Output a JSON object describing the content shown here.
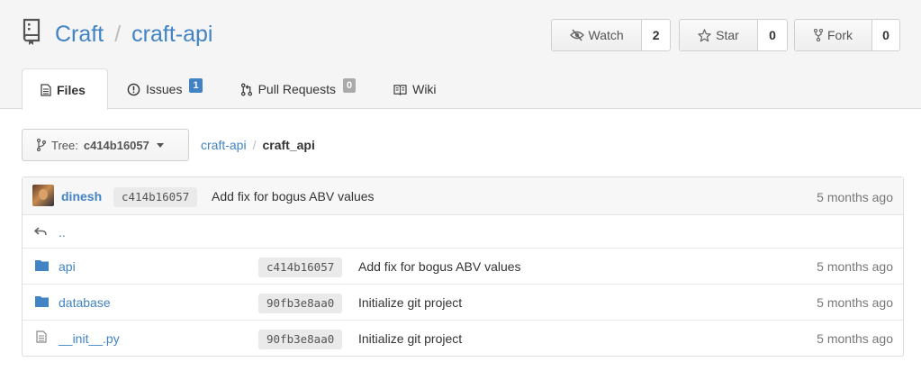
{
  "repo": {
    "owner": "Craft",
    "separator": "/",
    "name": "craft-api"
  },
  "actions": {
    "watch": {
      "label": "Watch",
      "count": "2"
    },
    "star": {
      "label": "Star",
      "count": "0"
    },
    "fork": {
      "label": "Fork",
      "count": "0"
    }
  },
  "tabs": [
    {
      "label": "Files",
      "icon": "file-icon",
      "active": true
    },
    {
      "label": "Issues",
      "icon": "issue-icon",
      "badge": "1"
    },
    {
      "label": "Pull Requests",
      "icon": "pull-request-icon",
      "badge": "0"
    },
    {
      "label": "Wiki",
      "icon": "book-icon"
    }
  ],
  "branch": {
    "label": "Tree:",
    "value": "c414b16057"
  },
  "breadcrumb": {
    "root": "craft-api",
    "separator": "/",
    "current": "craft_api"
  },
  "latest_commit": {
    "author": "dinesh",
    "sha": "c414b16057",
    "message": "Add fix for bogus ABV values",
    "age": "5 months ago"
  },
  "parent_dir": "..",
  "entries": [
    {
      "name": "api",
      "type": "folder",
      "sha": "c414b16057",
      "message": "Add fix for bogus ABV values",
      "age": "5 months ago"
    },
    {
      "name": "database",
      "type": "folder",
      "sha": "90fb3e8aa0",
      "message": "Initialize git project",
      "age": "5 months ago"
    },
    {
      "name": "__init__.py",
      "type": "file",
      "sha": "90fb3e8aa0",
      "message": "Initialize git project",
      "age": "5 months ago"
    }
  ],
  "colors": {
    "link": "#4183c4",
    "header_bg": "#f5f5f5",
    "folder": "#4183c4",
    "issue_badge": "#4183c4",
    "pr_badge": "#aaaaaa"
  }
}
